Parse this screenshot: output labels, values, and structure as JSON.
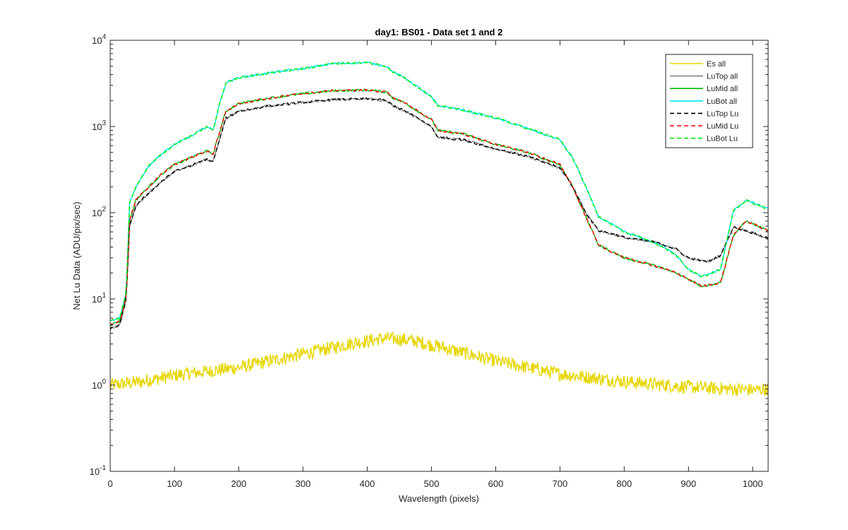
{
  "chart_data": {
    "type": "line",
    "title": "day1: BS01 - Data set 1 and 2",
    "xlabel": "Wavelength (pixels)",
    "ylabel": "Net Lu Data (ADU/pix/sec)",
    "xlim": [
      0,
      1024
    ],
    "ylim": [
      0.1,
      10000
    ],
    "yscale": "log",
    "grid": false,
    "legend_position": "top-right",
    "xticks": [
      0,
      100,
      200,
      300,
      400,
      500,
      600,
      700,
      800,
      900,
      1000
    ],
    "yticks": [
      {
        "value": 0.1,
        "base": "10",
        "exp": "-1"
      },
      {
        "value": 1,
        "base": "10",
        "exp": "0"
      },
      {
        "value": 10,
        "base": "10",
        "exp": "1"
      },
      {
        "value": 100,
        "base": "10",
        "exp": "2"
      },
      {
        "value": 1000,
        "base": "10",
        "exp": "3"
      },
      {
        "value": 10000,
        "base": "10",
        "exp": "4"
      }
    ],
    "series": [
      {
        "name": "Es  all",
        "color": "#e6d600",
        "style": "solid",
        "noise": 0.18,
        "points": [
          [
            0,
            1.0
          ],
          [
            50,
            1.1
          ],
          [
            100,
            1.3
          ],
          [
            200,
            1.6
          ],
          [
            300,
            2.3
          ],
          [
            380,
            3.1
          ],
          [
            430,
            3.5
          ],
          [
            470,
            3.3
          ],
          [
            520,
            2.7
          ],
          [
            600,
            1.9
          ],
          [
            700,
            1.35
          ],
          [
            800,
            1.1
          ],
          [
            900,
            0.95
          ],
          [
            1000,
            0.88
          ],
          [
            1024,
            0.9
          ]
        ]
      },
      {
        "name": "LuTop  all",
        "color": "#808080",
        "style": "solid",
        "points": [
          [
            0,
            4.5
          ],
          [
            15,
            5
          ],
          [
            25,
            10
          ],
          [
            30,
            70
          ],
          [
            40,
            120
          ],
          [
            60,
            170
          ],
          [
            80,
            230
          ],
          [
            100,
            300
          ],
          [
            130,
            360
          ],
          [
            150,
            420
          ],
          [
            160,
            390
          ],
          [
            170,
            700
          ],
          [
            180,
            1250
          ],
          [
            200,
            1500
          ],
          [
            250,
            1750
          ],
          [
            300,
            1900
          ],
          [
            350,
            2050
          ],
          [
            400,
            2100
          ],
          [
            430,
            2000
          ],
          [
            440,
            1750
          ],
          [
            460,
            1500
          ],
          [
            500,
            1000
          ],
          [
            510,
            750
          ],
          [
            550,
            700
          ],
          [
            600,
            550
          ],
          [
            650,
            450
          ],
          [
            700,
            330
          ],
          [
            720,
            200
          ],
          [
            740,
            100
          ],
          [
            760,
            62
          ],
          [
            800,
            52
          ],
          [
            850,
            45
          ],
          [
            880,
            38
          ],
          [
            900,
            30
          ],
          [
            930,
            27
          ],
          [
            950,
            32
          ],
          [
            970,
            68
          ],
          [
            990,
            62
          ],
          [
            1024,
            50
          ]
        ]
      },
      {
        "name": "LuMid  all",
        "color": "#00bb00",
        "style": "solid",
        "points": [
          [
            0,
            5
          ],
          [
            15,
            5.5
          ],
          [
            25,
            11
          ],
          [
            30,
            80
          ],
          [
            40,
            140
          ],
          [
            60,
            200
          ],
          [
            80,
            280
          ],
          [
            100,
            360
          ],
          [
            130,
            450
          ],
          [
            150,
            520
          ],
          [
            160,
            480
          ],
          [
            170,
            850
          ],
          [
            180,
            1500
          ],
          [
            200,
            1850
          ],
          [
            250,
            2150
          ],
          [
            300,
            2400
          ],
          [
            350,
            2600
          ],
          [
            400,
            2650
          ],
          [
            430,
            2500
          ],
          [
            440,
            2150
          ],
          [
            460,
            1850
          ],
          [
            500,
            1200
          ],
          [
            510,
            900
          ],
          [
            550,
            820
          ],
          [
            600,
            620
          ],
          [
            650,
            500
          ],
          [
            700,
            360
          ],
          [
            720,
            200
          ],
          [
            740,
            90
          ],
          [
            760,
            42
          ],
          [
            800,
            30
          ],
          [
            850,
            24
          ],
          [
            880,
            20
          ],
          [
            900,
            17
          ],
          [
            920,
            14
          ],
          [
            950,
            15.5
          ],
          [
            970,
            55
          ],
          [
            990,
            80
          ],
          [
            1024,
            62
          ]
        ]
      },
      {
        "name": "LuBot  all",
        "color": "#00e6ff",
        "style": "solid",
        "points": [
          [
            0,
            5.5
          ],
          [
            15,
            6
          ],
          [
            25,
            12
          ],
          [
            30,
            130
          ],
          [
            40,
            200
          ],
          [
            60,
            350
          ],
          [
            80,
            480
          ],
          [
            100,
            620
          ],
          [
            130,
            800
          ],
          [
            150,
            1000
          ],
          [
            160,
            900
          ],
          [
            170,
            1800
          ],
          [
            180,
            3200
          ],
          [
            200,
            3700
          ],
          [
            250,
            4200
          ],
          [
            300,
            4700
          ],
          [
            350,
            5400
          ],
          [
            400,
            5500
          ],
          [
            430,
            5000
          ],
          [
            440,
            4300
          ],
          [
            460,
            3600
          ],
          [
            500,
            2200
          ],
          [
            510,
            1750
          ],
          [
            550,
            1550
          ],
          [
            600,
            1250
          ],
          [
            650,
            950
          ],
          [
            700,
            700
          ],
          [
            720,
            430
          ],
          [
            740,
            200
          ],
          [
            760,
            90
          ],
          [
            800,
            60
          ],
          [
            850,
            44
          ],
          [
            880,
            33
          ],
          [
            900,
            22
          ],
          [
            920,
            18
          ],
          [
            950,
            22
          ],
          [
            970,
            105
          ],
          [
            990,
            140
          ],
          [
            1024,
            110
          ]
        ]
      },
      {
        "name": "LuTop  Lu",
        "color": "#000000",
        "style": "dashed",
        "points": [
          [
            0,
            4.5
          ],
          [
            15,
            5
          ],
          [
            25,
            10
          ],
          [
            30,
            70
          ],
          [
            40,
            120
          ],
          [
            60,
            170
          ],
          [
            80,
            230
          ],
          [
            100,
            300
          ],
          [
            130,
            360
          ],
          [
            150,
            420
          ],
          [
            160,
            390
          ],
          [
            170,
            700
          ],
          [
            180,
            1250
          ],
          [
            200,
            1500
          ],
          [
            250,
            1750
          ],
          [
            300,
            1900
          ],
          [
            350,
            2050
          ],
          [
            400,
            2100
          ],
          [
            430,
            2000
          ],
          [
            440,
            1750
          ],
          [
            460,
            1500
          ],
          [
            500,
            1000
          ],
          [
            510,
            750
          ],
          [
            550,
            700
          ],
          [
            600,
            550
          ],
          [
            650,
            450
          ],
          [
            700,
            330
          ],
          [
            720,
            200
          ],
          [
            740,
            100
          ],
          [
            760,
            62
          ],
          [
            800,
            52
          ],
          [
            850,
            45
          ],
          [
            880,
            38
          ],
          [
            900,
            30
          ],
          [
            930,
            27
          ],
          [
            950,
            32
          ],
          [
            970,
            68
          ],
          [
            990,
            62
          ],
          [
            1024,
            50
          ]
        ]
      },
      {
        "name": "LuMid  Lu",
        "color": "#ff0000",
        "style": "dashed",
        "points": [
          [
            0,
            5
          ],
          [
            15,
            5.5
          ],
          [
            25,
            11
          ],
          [
            30,
            80
          ],
          [
            40,
            140
          ],
          [
            60,
            200
          ],
          [
            80,
            280
          ],
          [
            100,
            360
          ],
          [
            130,
            450
          ],
          [
            150,
            520
          ],
          [
            160,
            480
          ],
          [
            170,
            850
          ],
          [
            180,
            1500
          ],
          [
            200,
            1850
          ],
          [
            250,
            2150
          ],
          [
            300,
            2400
          ],
          [
            350,
            2600
          ],
          [
            400,
            2650
          ],
          [
            430,
            2500
          ],
          [
            440,
            2150
          ],
          [
            460,
            1850
          ],
          [
            500,
            1200
          ],
          [
            510,
            900
          ],
          [
            550,
            820
          ],
          [
            600,
            620
          ],
          [
            650,
            500
          ],
          [
            700,
            360
          ],
          [
            720,
            200
          ],
          [
            740,
            90
          ],
          [
            760,
            42
          ],
          [
            800,
            30
          ],
          [
            850,
            24
          ],
          [
            880,
            20
          ],
          [
            900,
            17
          ],
          [
            920,
            14
          ],
          [
            950,
            15.5
          ],
          [
            970,
            55
          ],
          [
            990,
            80
          ],
          [
            1024,
            62
          ]
        ]
      },
      {
        "name": "LuBot  Lu",
        "color": "#00ee00",
        "style": "dashed",
        "points": [
          [
            0,
            5.5
          ],
          [
            15,
            6
          ],
          [
            25,
            12
          ],
          [
            30,
            130
          ],
          [
            40,
            200
          ],
          [
            60,
            350
          ],
          [
            80,
            480
          ],
          [
            100,
            620
          ],
          [
            130,
            800
          ],
          [
            150,
            1000
          ],
          [
            160,
            900
          ],
          [
            170,
            1800
          ],
          [
            180,
            3200
          ],
          [
            200,
            3700
          ],
          [
            250,
            4200
          ],
          [
            300,
            4700
          ],
          [
            350,
            5400
          ],
          [
            400,
            5500
          ],
          [
            430,
            5000
          ],
          [
            440,
            4300
          ],
          [
            460,
            3600
          ],
          [
            500,
            2200
          ],
          [
            510,
            1750
          ],
          [
            550,
            1550
          ],
          [
            600,
            1250
          ],
          [
            650,
            950
          ],
          [
            700,
            700
          ],
          [
            720,
            430
          ],
          [
            740,
            200
          ],
          [
            760,
            90
          ],
          [
            800,
            60
          ],
          [
            850,
            44
          ],
          [
            880,
            33
          ],
          [
            900,
            22
          ],
          [
            920,
            18
          ],
          [
            950,
            22
          ],
          [
            970,
            105
          ],
          [
            990,
            140
          ],
          [
            1024,
            110
          ]
        ]
      }
    ]
  }
}
